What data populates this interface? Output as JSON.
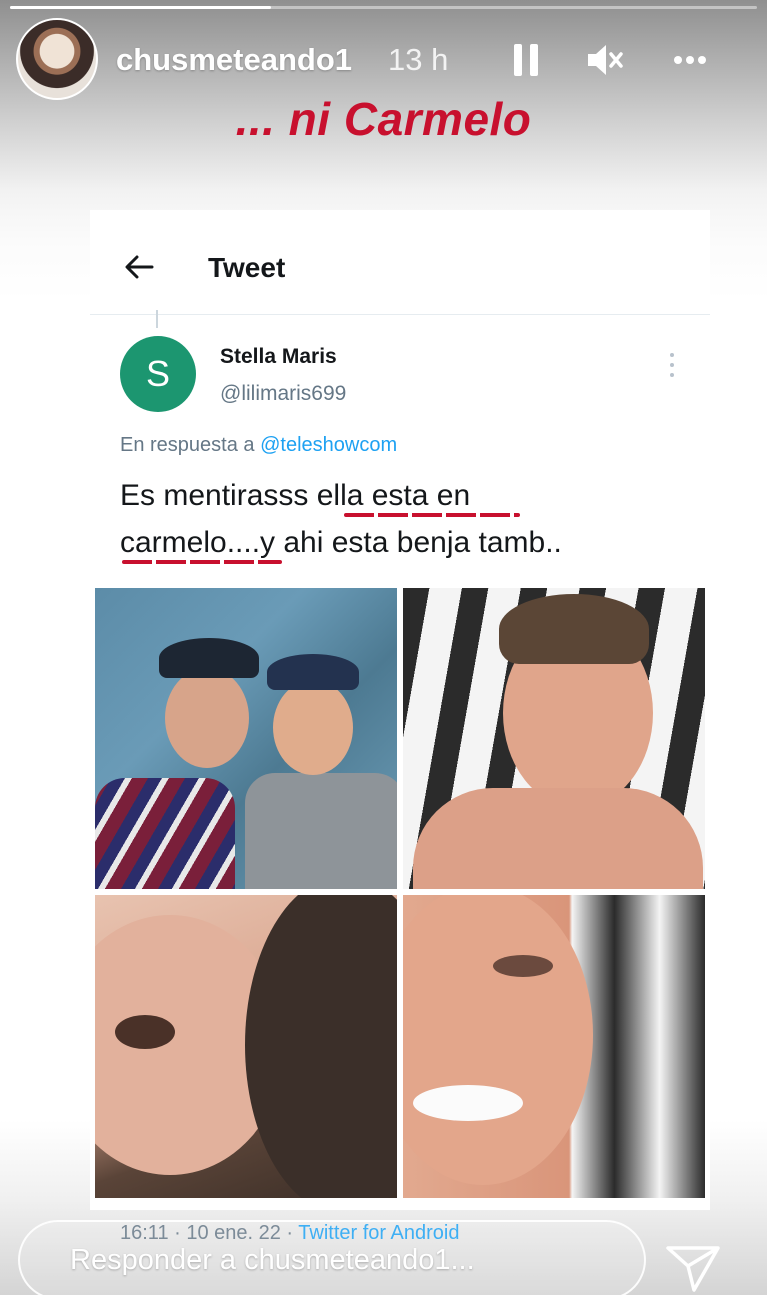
{
  "story": {
    "progress": 0.35,
    "username": "chusmeteando1",
    "time_ago": "13 h",
    "caption": "... ni Carmelo",
    "reply_placeholder": "Responder a chusmeteando1..."
  },
  "tweet": {
    "screen_title": "Tweet",
    "author_initial": "S",
    "author_name": "Stella Maris",
    "author_handle": "@lilimaris699",
    "reply_prefix": "En respuesta a ",
    "reply_mention": "@teleshowcom",
    "text_line1": "Es mentirasss ella esta en",
    "text_line2": "carmelo....y ahi esta benja tamb..",
    "timestamp": "16:11 · 10 ene. 22 · ",
    "source": "Twitter for Android",
    "avatar_color": "#1c9670"
  },
  "colors": {
    "caption": "#c8102e",
    "link": "#1da1f2",
    "muted": "#657786"
  },
  "icons": [
    "pause-icon",
    "mute-icon",
    "more-icon",
    "back-arrow-icon",
    "tweet-more-icon",
    "send-icon"
  ]
}
